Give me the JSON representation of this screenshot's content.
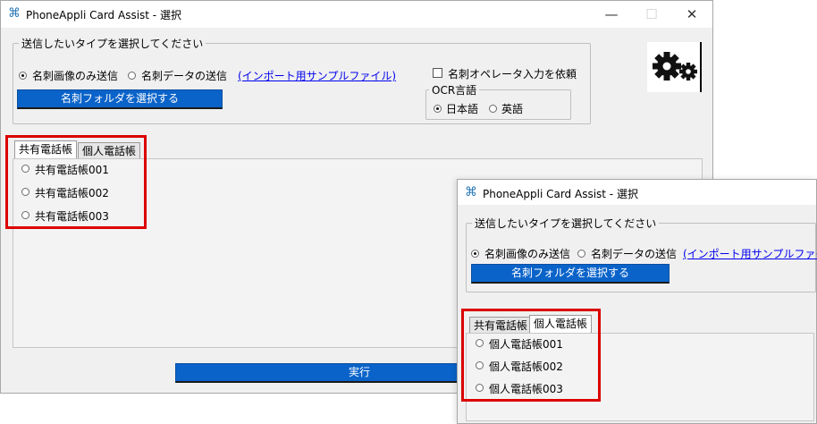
{
  "main_window": {
    "title": "PhoneAppli Card Assist - 選択",
    "caption": {
      "minimize": "—",
      "maximize": "☐",
      "close": "✕"
    },
    "send_type_group": {
      "legend": "送信したいタイプを選択してください",
      "option_image": "名刺画像のみ送信",
      "option_data": "名刺データの送信",
      "sample_link": "(インポート用サンプルファイル)",
      "select_folder_button": "名刺フォルダを選択する",
      "operator_checkbox": "名刺オペレータ入力を依頼",
      "ocr_group": {
        "legend": "OCR言語",
        "japanese": "日本語",
        "english": "英語"
      }
    },
    "tabs": [
      {
        "label": "共有電話帳"
      },
      {
        "label": "個人電話帳"
      }
    ],
    "shared_items": [
      {
        "label": "共有電話帳001"
      },
      {
        "label": "共有電話帳002"
      },
      {
        "label": "共有電話帳003"
      }
    ],
    "run_button": "実行"
  },
  "sub_window": {
    "title": "PhoneAppli Card Assist - 選択",
    "send_type_group": {
      "legend": "送信したいタイプを選択してください",
      "option_image": "名刺画像のみ送信",
      "option_data": "名刺データの送信",
      "sample_link": "(インポート用サンプルファイル)",
      "select_folder_button": "名刺フォルダを選択する"
    },
    "tabs": [
      {
        "label": "共有電話帳"
      },
      {
        "label": "個人電話帳"
      }
    ],
    "personal_items": [
      {
        "label": "個人電話帳001"
      },
      {
        "label": "個人電話帳002"
      },
      {
        "label": "個人電話帳003"
      }
    ]
  },
  "colors": {
    "highlight": "#dc0000",
    "button_blue": "#0a63c9",
    "link": "#0000ee"
  },
  "icons": {
    "app": "app-icon",
    "settings": "gear-icon"
  }
}
